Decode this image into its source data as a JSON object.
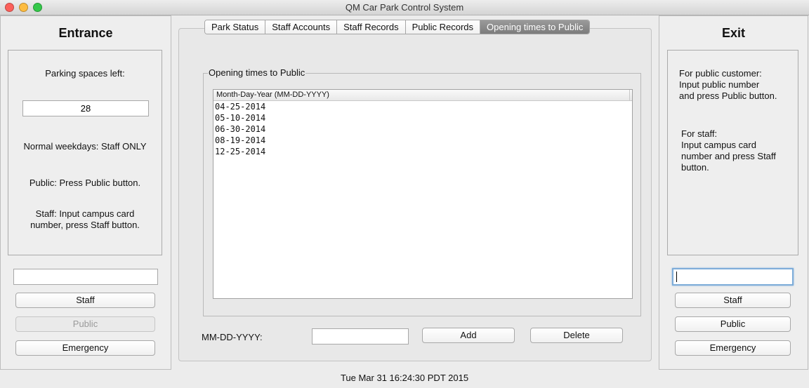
{
  "window": {
    "title": "QM Car Park Control System"
  },
  "entrance": {
    "title": "Entrance",
    "spaces_label": "Parking spaces left:",
    "spaces_value": "28",
    "weekday_text": "Normal weekdays: Staff ONLY",
    "public_text": "Public: Press Public button.",
    "staff_text_1": "Staff: Input campus card",
    "staff_text_2": "number, press Staff button.",
    "card_input_value": "",
    "staff_button": "Staff",
    "public_button": "Public",
    "emergency_button": "Emergency"
  },
  "tabs": [
    {
      "label": "Park Status",
      "active": false
    },
    {
      "label": "Staff Accounts",
      "active": false
    },
    {
      "label": "Staff Records",
      "active": false
    },
    {
      "label": "Public Records",
      "active": false
    },
    {
      "label": "Opening times to Public",
      "active": true
    }
  ],
  "opening_times": {
    "group_label": "Opening times to Public",
    "column_header": "Month-Day-Year (MM-DD-YYYY)",
    "rows": [
      "04-25-2014",
      "05-10-2014",
      "06-30-2014",
      "08-19-2014",
      "12-25-2014"
    ],
    "date_label": "MM-DD-YYYY:",
    "date_input_value": "",
    "add_button": "Add",
    "delete_button": "Delete"
  },
  "exit": {
    "title": "Exit",
    "public_text_1": "For public customer:",
    "public_text_2": "Input public number",
    "public_text_3": "and press Public button.",
    "staff_text_1": "For staff:",
    "staff_text_2": "Input campus card",
    "staff_text_3": "number and press Staff",
    "staff_text_4": "button.",
    "card_input_value": "",
    "staff_button": "Staff",
    "public_button": "Public",
    "emergency_button": "Emergency"
  },
  "status": {
    "datetime": "Tue Mar 31 16:24:30 PDT 2015"
  },
  "colors": {
    "active_tab": "#8a8a8a",
    "focus_ring": "#7eadd9",
    "close": "#fc605b",
    "minimize": "#fdbc40",
    "maximize": "#34c84a"
  }
}
